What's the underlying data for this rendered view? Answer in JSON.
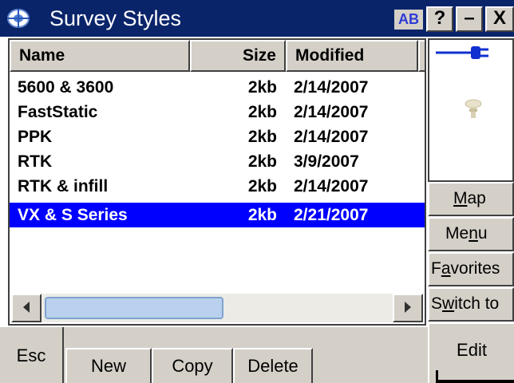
{
  "title_bar": {
    "title": "Survey Styles",
    "input_mode": "AB",
    "help_label": "?",
    "minimize_label": "–",
    "close_label": "X"
  },
  "columns": {
    "name": "Name",
    "size": "Size",
    "modified": "Modified"
  },
  "rows": [
    {
      "name": "5600 & 3600",
      "size": "2kb",
      "modified": "2/14/2007",
      "selected": false
    },
    {
      "name": "FastStatic",
      "size": "2kb",
      "modified": "2/14/2007",
      "selected": false
    },
    {
      "name": "PPK",
      "size": "2kb",
      "modified": "2/14/2007",
      "selected": false
    },
    {
      "name": "RTK",
      "size": "2kb",
      "modified": "3/9/2007",
      "selected": false
    },
    {
      "name": "RTK & infill",
      "size": "2kb",
      "modified": "2/14/2007",
      "selected": false
    },
    {
      "name": "VX & S Series",
      "size": "2kb",
      "modified": "2/21/2007",
      "selected": true
    }
  ],
  "side_buttons": {
    "map": {
      "pre": "",
      "u": "M",
      "post": "ap"
    },
    "menu": {
      "pre": "Me",
      "u": "n",
      "post": "u"
    },
    "favorites": {
      "pre": "F",
      "u": "a",
      "post": "vorites"
    },
    "switch_to": {
      "pre": "S",
      "u": "w",
      "post": "itch to"
    }
  },
  "bottom": {
    "esc": "Esc",
    "new": "New",
    "copy": "Copy",
    "delete": "Delete",
    "edit": "Edit"
  },
  "icons": {
    "app": "survey-app-icon",
    "battery": "external-power-icon",
    "receiver": "gnss-receiver-icon",
    "scroll_left": "arrow-left-icon",
    "scroll_right": "arrow-right-icon"
  },
  "colors": {
    "title_bar": "#0a246a",
    "selection": "#0000ff",
    "button_face": "#d4d0c8",
    "input_mode_text": "#2e3bd6"
  }
}
